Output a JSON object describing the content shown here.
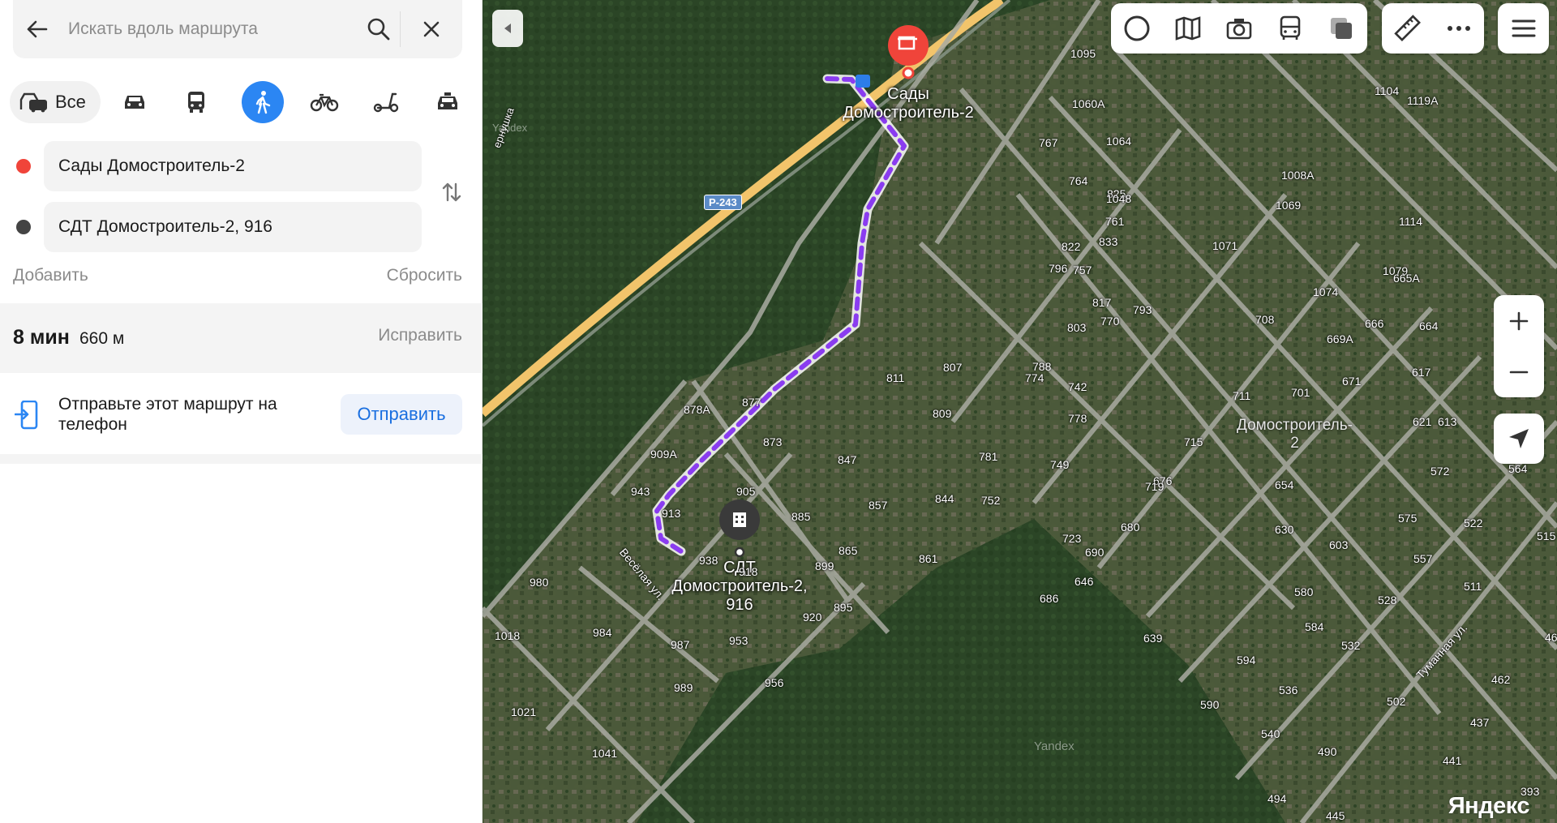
{
  "search": {
    "placeholder": "Искать вдоль маршрута"
  },
  "modes": {
    "all_label": "Все"
  },
  "route": {
    "from": "Сады Домостроитель-2",
    "to": "СДТ Домостроитель-2, 916",
    "add_label": "Добавить",
    "reset_label": "Сбросить",
    "time": "8 мин",
    "distance": "660 м",
    "fix_label": "Исправить"
  },
  "send": {
    "text": "Отправьте этот маршрут на телефон",
    "button": "Отправить"
  },
  "map": {
    "start_poi": [
      "Сады",
      "Домостроитель-2"
    ],
    "end_poi": [
      "СДТ",
      "Домостроитель-2,",
      "916"
    ],
    "area_label": [
      "Домостроитель-",
      "2"
    ],
    "road_badge": "Р-243",
    "river_label": "ернушка",
    "street_1": "Весёлая ул.",
    "street_2": "Туманная ул.",
    "watermark_1": "Yandex",
    "watermark_2": "Yandex",
    "brand": "Яндекс",
    "plots": [
      {
        "t": "1095"
      },
      {
        "t": "1060А"
      },
      {
        "t": "1104"
      },
      {
        "t": "1119А"
      },
      {
        "t": "767"
      },
      {
        "t": "1064"
      },
      {
        "t": "764"
      },
      {
        "t": "1008А"
      },
      {
        "t": "825"
      },
      {
        "t": "1048"
      },
      {
        "t": "1069"
      },
      {
        "t": "761"
      },
      {
        "t": "1114"
      },
      {
        "t": "833"
      },
      {
        "t": "822"
      },
      {
        "t": "1071"
      },
      {
        "t": "796"
      },
      {
        "t": "757"
      },
      {
        "t": "1079"
      },
      {
        "t": "665А"
      },
      {
        "t": "1074"
      },
      {
        "t": "817"
      },
      {
        "t": "793"
      },
      {
        "t": "803"
      },
      {
        "t": "770"
      },
      {
        "t": "708"
      },
      {
        "t": "666"
      },
      {
        "t": "664"
      },
      {
        "t": "669А"
      },
      {
        "t": "788"
      },
      {
        "t": "807"
      },
      {
        "t": "774"
      },
      {
        "t": "742"
      },
      {
        "t": "671"
      },
      {
        "t": "617"
      },
      {
        "t": "811"
      },
      {
        "t": "711"
      },
      {
        "t": "701"
      },
      {
        "t": "877"
      },
      {
        "t": "878А"
      },
      {
        "t": "809"
      },
      {
        "t": "778"
      },
      {
        "t": "621"
      },
      {
        "t": "613"
      },
      {
        "t": "873"
      },
      {
        "t": "715"
      },
      {
        "t": "781"
      },
      {
        "t": "909А"
      },
      {
        "t": "847"
      },
      {
        "t": "749"
      },
      {
        "t": "572"
      },
      {
        "t": "564"
      },
      {
        "t": "943"
      },
      {
        "t": "905"
      },
      {
        "t": "676"
      },
      {
        "t": "654"
      },
      {
        "t": "719"
      },
      {
        "t": "913"
      },
      {
        "t": "885"
      },
      {
        "t": "857"
      },
      {
        "t": "844"
      },
      {
        "t": "752"
      },
      {
        "t": "575"
      },
      {
        "t": "522"
      },
      {
        "t": "630"
      },
      {
        "t": "680"
      },
      {
        "t": "723"
      },
      {
        "t": "603"
      },
      {
        "t": "865"
      },
      {
        "t": "938"
      },
      {
        "t": "918"
      },
      {
        "t": "899"
      },
      {
        "t": "861"
      },
      {
        "t": "690"
      },
      {
        "t": "557"
      },
      {
        "t": "646"
      },
      {
        "t": "980"
      },
      {
        "t": "511"
      },
      {
        "t": "580"
      },
      {
        "t": "528"
      },
      {
        "t": "686"
      },
      {
        "t": "895"
      },
      {
        "t": "920"
      },
      {
        "t": "1018"
      },
      {
        "t": "984"
      },
      {
        "t": "987"
      },
      {
        "t": "953"
      },
      {
        "t": "584"
      },
      {
        "t": "639"
      },
      {
        "t": "532"
      },
      {
        "t": "594"
      },
      {
        "t": "956"
      },
      {
        "t": "989"
      },
      {
        "t": "462"
      },
      {
        "t": "536"
      },
      {
        "t": "1021"
      },
      {
        "t": "502"
      },
      {
        "t": "590"
      },
      {
        "t": "437"
      },
      {
        "t": "540"
      },
      {
        "t": "1041"
      },
      {
        "t": "490"
      },
      {
        "t": "441"
      },
      {
        "t": "393"
      },
      {
        "t": "494"
      },
      {
        "t": "445"
      },
      {
        "t": "515"
      },
      {
        "t": "46"
      }
    ]
  },
  "colors": {
    "accent": "#2b86f3",
    "route": "#8a3cf0",
    "start": "#f0443a",
    "end": "#333333"
  }
}
